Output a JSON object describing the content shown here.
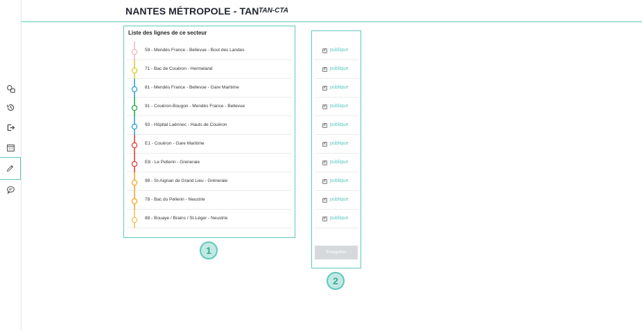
{
  "header": {
    "title": "NANTES MÉTROPOLE - TAN",
    "subtitle": "TAN-CTA"
  },
  "sidebar": {
    "icons": [
      {
        "name": "bus-stop-icon",
        "active": false
      },
      {
        "name": "history-icon",
        "active": false
      },
      {
        "name": "logout-icon",
        "active": false
      },
      {
        "name": "calendar-icon",
        "active": false
      },
      {
        "name": "pencil-icon",
        "active": true
      },
      {
        "name": "comment-icon",
        "active": false
      }
    ]
  },
  "lines_panel": {
    "title": "Liste des lignes de ce secteur",
    "lines": [
      {
        "label": "59 - Mendès France - Bellevue - Bout des Landes",
        "color": "#f4b6c2"
      },
      {
        "label": "71 - Bac de Couëron - Hermeland",
        "color": "#d8cc2e"
      },
      {
        "label": "81 - Mendès France - Bellevue - Gare Maritime",
        "color": "#2aa3c9"
      },
      {
        "label": "91 - Couëron-Bougon - Mendès France - Bellevue",
        "color": "#24a84a"
      },
      {
        "label": "93 - Hôpital Laënnec - Hauts de Couëron",
        "color": "#2aa3c9"
      },
      {
        "label": "E1 - Couëron - Gare Maritime",
        "color": "#e23a3a"
      },
      {
        "label": "E8 - Le Pellerin - Greneraie",
        "color": "#e23a3a"
      },
      {
        "label": "98 - St-Aignan de Grand Lieu - Gréneraie",
        "color": "#f3a623"
      },
      {
        "label": "78 - Bac du Pellerin - Neustrie",
        "color": "#f3a623"
      },
      {
        "label": "88 - Bouaye / Brains / St-Léger - Neustrie",
        "color": "#f6c25a"
      }
    ]
  },
  "status_panel": {
    "items": [
      {
        "label": "publique",
        "checked": true
      },
      {
        "label": "publique",
        "checked": true
      },
      {
        "label": "publique",
        "checked": true
      },
      {
        "label": "publique",
        "checked": true
      },
      {
        "label": "publique",
        "checked": true
      },
      {
        "label": "publique",
        "checked": true
      },
      {
        "label": "publique",
        "checked": true
      },
      {
        "label": "publique",
        "checked": true
      },
      {
        "label": "publique",
        "checked": true
      },
      {
        "label": "publique",
        "checked": true
      }
    ],
    "save_label": "Enregistrer"
  },
  "callouts": [
    "1",
    "2"
  ],
  "colors": {
    "accent": "#5dc8bc",
    "callout_fill": "#c2e9e3"
  }
}
